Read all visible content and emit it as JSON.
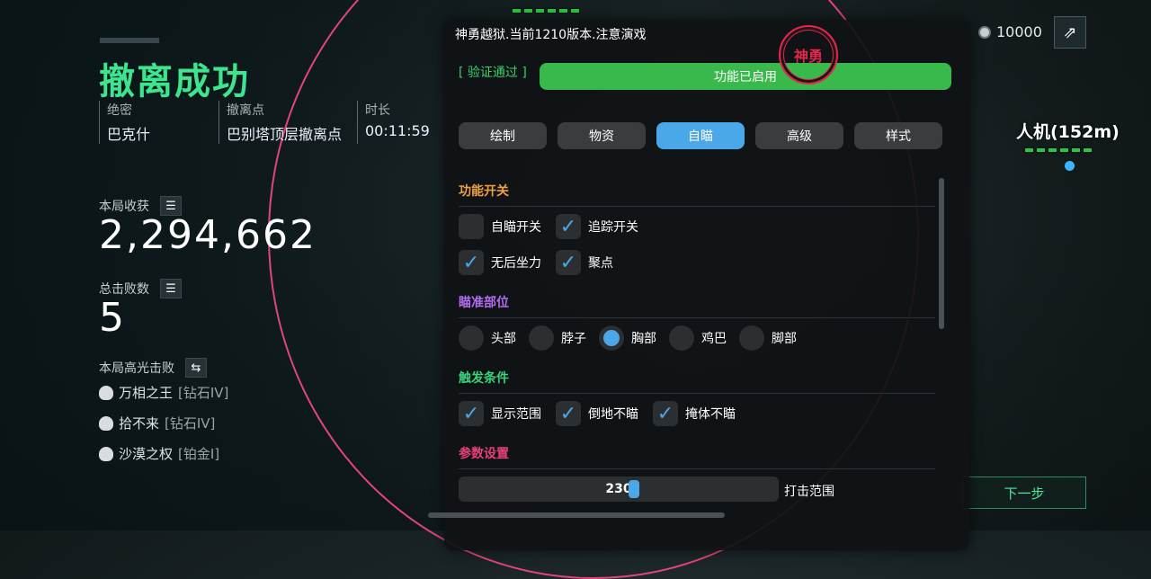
{
  "result": {
    "title": "撤离成功",
    "info": [
      {
        "key": "绝密",
        "value": "巴克什"
      },
      {
        "key": "撤离点",
        "value": "巴别塔顶层撤离点"
      },
      {
        "key": "时长",
        "value": "00:11:59"
      }
    ],
    "earnings_label": "本局收获",
    "earnings_value": "2,294,662",
    "kills_label": "总击败数",
    "kills_value": "5",
    "highlight_label": "本局高光击败",
    "highlights": [
      {
        "name": "万相之王",
        "rank": "[钻石IV]"
      },
      {
        "name": "拾不来",
        "rank": "[钻石IV]"
      },
      {
        "name": "沙漠之权",
        "rank": "[铂金I]"
      }
    ],
    "next_label": "下一步"
  },
  "topbar": {
    "coins": "10000"
  },
  "enemies": [
    {
      "label": "人机(152m)",
      "hp_segments": 6
    }
  ],
  "menu": {
    "title": "神勇越狱.当前1210版本.注意演戏",
    "stamp": "神勇",
    "verify_label": "[ 验证通过 ]",
    "status_label": "功能已启用",
    "tabs": [
      "绘制",
      "物资",
      "自瞄",
      "高级",
      "样式"
    ],
    "active_tab": "自瞄",
    "sections": {
      "features": "功能开关",
      "aim_part": "瞄准部位",
      "trigger": "触发条件",
      "params": "参数设置"
    },
    "feature_options": [
      {
        "label": "自瞄开关",
        "checked": false
      },
      {
        "label": "追踪开关",
        "checked": true
      },
      {
        "label": "无后坐力",
        "checked": true
      },
      {
        "label": "聚点",
        "checked": true
      }
    ],
    "aim_parts": [
      {
        "label": "头部",
        "selected": false
      },
      {
        "label": "脖子",
        "selected": false
      },
      {
        "label": "胸部",
        "selected": true
      },
      {
        "label": "鸡巴",
        "selected": false
      },
      {
        "label": "脚部",
        "selected": false
      }
    ],
    "trigger_options": [
      {
        "label": "显示范围",
        "checked": true
      },
      {
        "label": "倒地不瞄",
        "checked": true
      },
      {
        "label": "掩体不瞄",
        "checked": true
      }
    ],
    "range_slider": {
      "label": "打击范围",
      "value": "230",
      "fraction": 0.55
    }
  },
  "colors": {
    "accent": "#4aa8e8",
    "success": "#3de58f",
    "fov": "#e0457b",
    "features": "#f0a040",
    "aim": "#b26cf2",
    "trigger": "#38d37a",
    "params": "#e8407a"
  }
}
